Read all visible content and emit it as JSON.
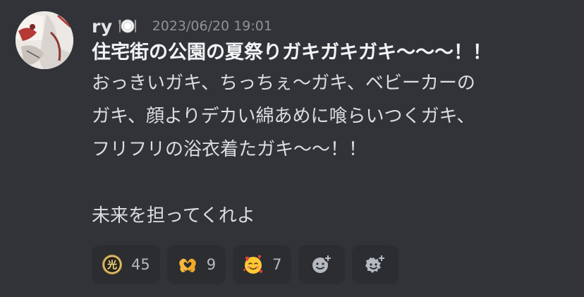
{
  "message": {
    "author": {
      "username": "ry",
      "username_emoji": "plate-with-cutlery-icon",
      "avatar": "avatar-illustration"
    },
    "timestamp": "2023/06/20 19:01",
    "title": "住宅街の公園の夏祭りガキガキガキ〜〜〜！！",
    "lines": [
      "おっきいガキ、ちっちぇ〜ガキ、ベビーカーの",
      "ガキ、顔よりデカい綿あめに喰らいつくガキ、",
      "フリフリの浴衣着たガキ〜〜！！",
      "",
      "未来を担ってくれよ"
    ]
  },
  "reactions": [
    {
      "emoji": "hikari-gold-coin-icon",
      "count": "45"
    },
    {
      "emoji": "heart-hands-icon",
      "count": "9"
    },
    {
      "emoji": "smiling-face-with-hearts-icon",
      "count": "7"
    }
  ],
  "add_reaction_buttons": [
    {
      "icon": "add-reaction-icon"
    },
    {
      "icon": "add-super-reaction-icon"
    }
  ]
}
